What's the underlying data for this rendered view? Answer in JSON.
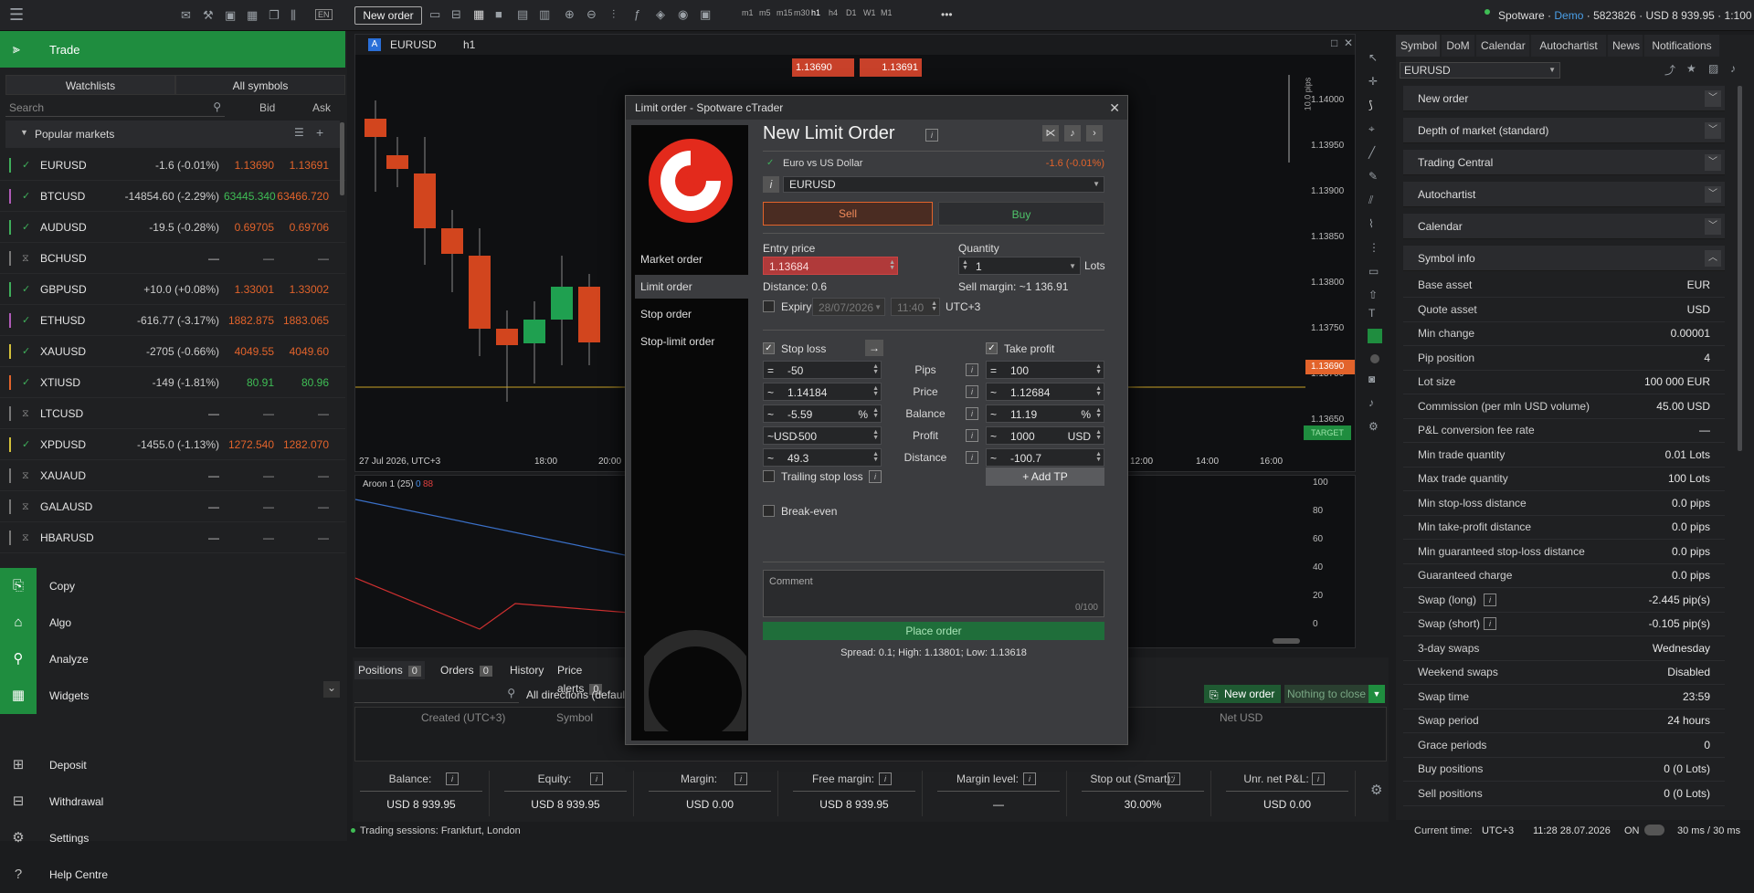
{
  "account": {
    "broker": "Spotware",
    "mode": "Demo",
    "number": "5823826",
    "balance": "USD 8 939.95",
    "leverage": "1:100"
  },
  "toolbar": {
    "new_order": "New order",
    "timeframes": [
      "m1",
      "m5",
      "m15",
      "m30",
      "h1",
      "h4",
      "D1",
      "W1",
      "M1"
    ],
    "more": "•••",
    "lang": "EN"
  },
  "left": {
    "title": "Trade",
    "watchlists": "Watchlists",
    "all_symbols": "All symbols",
    "search_placeholder": "Search",
    "col_bid": "Bid",
    "col_ask": "Ask",
    "group": "Popular markets",
    "rows": [
      {
        "sym": "EURUSD",
        "chg": "-1.6 (-0.01%)",
        "bid": "1.13690",
        "ask": "1.13691",
        "bc": "red",
        "ac": "red",
        "mark": "#3fae5a"
      },
      {
        "sym": "BTCUSD",
        "chg": "-14854.60 (-2.29%)",
        "bid": "63445.340",
        "ask": "63466.720",
        "bc": "grn",
        "ac": "red",
        "mark": "#b05bb8"
      },
      {
        "sym": "AUDUSD",
        "chg": "-19.5 (-0.28%)",
        "bid": "0.69705",
        "ask": "0.69706",
        "bc": "red",
        "ac": "red",
        "mark": "#3fae5a"
      },
      {
        "sym": "BCHUSD",
        "chg": "—",
        "bid": "—",
        "ask": "—",
        "bc": "gray",
        "ac": "gray",
        "mark": "#777"
      },
      {
        "sym": "GBPUSD",
        "chg": "+10.0 (+0.08%)",
        "bid": "1.33001",
        "ask": "1.33002",
        "bc": "red",
        "ac": "red",
        "mark": "#3fae5a"
      },
      {
        "sym": "ETHUSD",
        "chg": "-616.77 (-3.17%)",
        "bid": "1882.875",
        "ask": "1883.065",
        "bc": "red",
        "ac": "red",
        "mark": "#b05bb8"
      },
      {
        "sym": "XAUUSD",
        "chg": "-2705 (-0.66%)",
        "bid": "4049.55",
        "ask": "4049.60",
        "bc": "red",
        "ac": "red",
        "mark": "#d4c13b"
      },
      {
        "sym": "XTIUSD",
        "chg": "-149 (-1.81%)",
        "bid": "80.91",
        "ask": "80.96",
        "bc": "grn",
        "ac": "grn",
        "mark": "#e2632b"
      },
      {
        "sym": "LTCUSD",
        "chg": "—",
        "bid": "—",
        "ask": "—",
        "bc": "gray",
        "ac": "gray",
        "mark": "#777"
      },
      {
        "sym": "XPDUSD",
        "chg": "-1455.0 (-1.13%)",
        "bid": "1272.540",
        "ask": "1282.070",
        "bc": "red",
        "ac": "red",
        "mark": "#d4c13b"
      },
      {
        "sym": "XAUAUD",
        "chg": "—",
        "bid": "—",
        "ask": "—",
        "bc": "gray",
        "ac": "gray",
        "mark": "#777"
      },
      {
        "sym": "GALAUSD",
        "chg": "—",
        "bid": "—",
        "ask": "—",
        "bc": "gray",
        "ac": "gray",
        "mark": "#777"
      },
      {
        "sym": "HBARUSD",
        "chg": "—",
        "bid": "—",
        "ask": "—",
        "bc": "gray",
        "ac": "gray",
        "mark": "#777"
      }
    ],
    "nav": [
      "Copy",
      "Algo",
      "Analyze",
      "Widgets"
    ],
    "nav2": [
      "Deposit",
      "Withdrawal",
      "Settings",
      "Help Centre"
    ]
  },
  "chart": {
    "symbol": "EURUSD",
    "tf": "h1",
    "sell": "1.13690",
    "buy": "1.13691",
    "pips_label": "10.0 pips",
    "date_label": "27 Jul 2026, UTC+3",
    "times": [
      "18:00",
      "20:00",
      "12:00",
      "14:00",
      "16:00"
    ],
    "prices": [
      "1.14000",
      "1.13950",
      "1.13900",
      "1.13850",
      "1.13800",
      "1.13750",
      "1.13700",
      "1.13650"
    ],
    "last": "1.13690",
    "target": "TARGET",
    "indicator": "Aroon 1 (25)",
    "ind_val1": "0",
    "ind_val2": "88",
    "ind_scale": [
      "100",
      "80",
      "60",
      "40",
      "20",
      "0"
    ]
  },
  "modal": {
    "title": "Limit order - Spotware cTrader",
    "heading": "New Limit Order",
    "types": [
      "Market order",
      "Limit order",
      "Stop order",
      "Stop-limit order"
    ],
    "instrument": "Euro vs US Dollar",
    "inst_chg": "-1.6 (-0.01%)",
    "symbol": "EURUSD",
    "sell": "Sell",
    "buy": "Buy",
    "entry_label": "Entry price",
    "entry": "1.13684",
    "qty_label": "Quantity",
    "qty": "1",
    "lots": "Lots",
    "distance": "Distance: 0.6",
    "margin": "Sell margin: ~1 136.91",
    "expiry": "Expiry",
    "exp_date": "28/07/2026",
    "exp_time": "11:40",
    "tz": "UTC+3",
    "sl": "Stop loss",
    "tp": "Take profit",
    "arrow": "→",
    "sl_vals": [
      "-50",
      "1.14184",
      "-5.59",
      "-500",
      "49.3"
    ],
    "sl_pref": [
      "=",
      "~",
      "~",
      "~USD",
      "~"
    ],
    "tp_vals": [
      "100",
      "1.12684",
      "11.19",
      "1000",
      "-100.7"
    ],
    "tp_pref": [
      "=",
      "~",
      "~",
      "~",
      "~"
    ],
    "mid": [
      "Pips",
      "Price",
      "Balance",
      "Profit",
      "Distance"
    ],
    "pct": "%",
    "usd": "USD",
    "trailing": "Trailing stop loss",
    "breakeven": "Break-even",
    "add_tp": "+ Add TP",
    "comment": "Comment",
    "count": "0/100",
    "place": "Place order",
    "spread": "Spread: 0.1; High: 1.13801; Low: 1.13618"
  },
  "bottom": {
    "tabs": [
      "Positions",
      "Orders",
      "History",
      "Price alerts"
    ],
    "counts": [
      "0",
      "0",
      "",
      "0"
    ],
    "filter": "All directions (default)",
    "new_order": "New order",
    "nothing": "Nothing to close",
    "cols": [
      "Created (UTC+3)",
      "Symbol",
      "Net USD"
    ],
    "stats": [
      {
        "c": "Balance:",
        "v": "USD 8 939.95"
      },
      {
        "c": "Equity:",
        "v": "USD 8 939.95"
      },
      {
        "c": "Margin:",
        "v": "USD 0.00"
      },
      {
        "c": "Free margin:",
        "v": "USD 8 939.95"
      },
      {
        "c": "Margin level:",
        "v": "—"
      },
      {
        "c": "Stop out (Smart):",
        "v": "30.00%"
      },
      {
        "c": "Unr. net P&L:",
        "v": "USD 0.00"
      }
    ]
  },
  "status": {
    "sessions": "Trading sessions: Frankfurt, London",
    "time_label": "Current time:",
    "tz": "UTC+3",
    "time": "11:28 28.07.2026",
    "on": "ON",
    "lat": "30 ms / 30 ms"
  },
  "right": {
    "tabs": [
      "Symbol",
      "DoM",
      "Calendar",
      "Autochartist",
      "News",
      "Notifications"
    ],
    "symbol": "EURUSD",
    "sections": [
      "New order",
      "Depth of market (standard)",
      "Trading Central",
      "Autochartist",
      "Calendar",
      "Symbol info"
    ],
    "info": [
      [
        "Base asset",
        "EUR"
      ],
      [
        "Quote asset",
        "USD"
      ],
      [
        "Min change",
        "0.00001"
      ],
      [
        "Pip position",
        "4"
      ],
      [
        "Lot size",
        "100 000 EUR"
      ],
      [
        "Commission (per mln USD volume)",
        "45.00 USD"
      ],
      [
        "P&L conversion fee rate",
        "—"
      ],
      [
        "Min trade quantity",
        "0.01 Lots"
      ],
      [
        "Max trade quantity",
        "100 Lots"
      ],
      [
        "Min stop-loss distance",
        "0.0 pips"
      ],
      [
        "Min take-profit distance",
        "0.0 pips"
      ],
      [
        "Min guaranteed stop-loss distance",
        "0.0 pips"
      ],
      [
        "Guaranteed charge",
        "0.0 pips"
      ],
      [
        "Swap (long)",
        "-2.445 pip(s)"
      ],
      [
        "Swap (short)",
        "-0.105 pip(s)"
      ],
      [
        "3-day swaps",
        "Wednesday"
      ],
      [
        "Weekend swaps",
        "Disabled"
      ],
      [
        "Swap time",
        "23:59"
      ],
      [
        "Swap period",
        "24 hours"
      ],
      [
        "Grace periods",
        "0"
      ],
      [
        "Buy positions",
        "0 (0 Lots)"
      ],
      [
        "Sell positions",
        "0 (0 Lots)"
      ]
    ]
  }
}
